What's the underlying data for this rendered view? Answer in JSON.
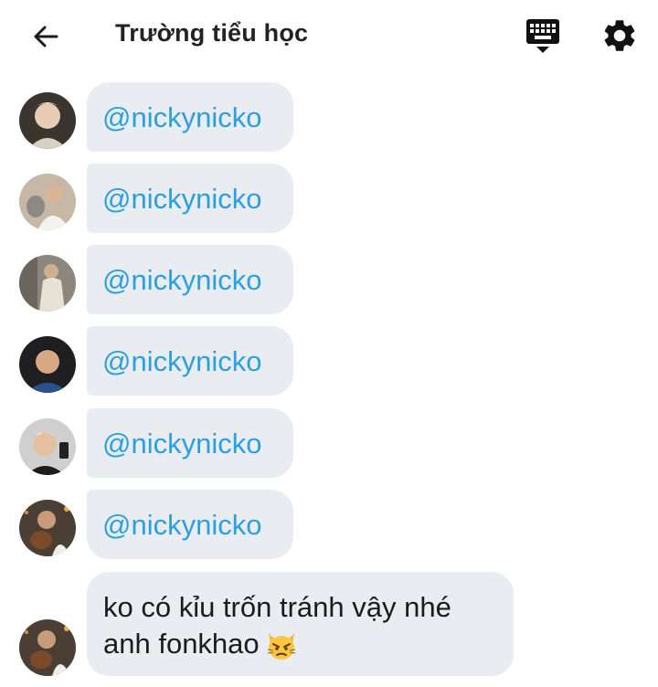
{
  "header": {
    "title": "Trường tiểu học",
    "back_icon": "arrow-back-icon",
    "keyboard_icon": "keyboard-icon",
    "settings_icon": "gear-icon"
  },
  "messages": [
    {
      "type": "mention",
      "text": "@nickynicko",
      "avatar": "avatar-1"
    },
    {
      "type": "mention",
      "text": "@nickynicko",
      "avatar": "avatar-2"
    },
    {
      "type": "mention",
      "text": "@nickynicko",
      "avatar": "avatar-3"
    },
    {
      "type": "mention",
      "text": "@nickynicko",
      "avatar": "avatar-4"
    },
    {
      "type": "mention",
      "text": "@nickynicko",
      "avatar": "avatar-5"
    },
    {
      "type": "mention",
      "text": "@nickynicko",
      "avatar": "avatar-6"
    },
    {
      "type": "text",
      "line1": "ko có kỉu trốn tránh vậy nhé",
      "line2": "anh fonkhao",
      "emoji": "pouting-cat-emoji",
      "avatar": "avatar-7"
    }
  ],
  "colors": {
    "mention": "#2aa0e0",
    "bubble": "#e9edf1",
    "title": "#222222"
  }
}
